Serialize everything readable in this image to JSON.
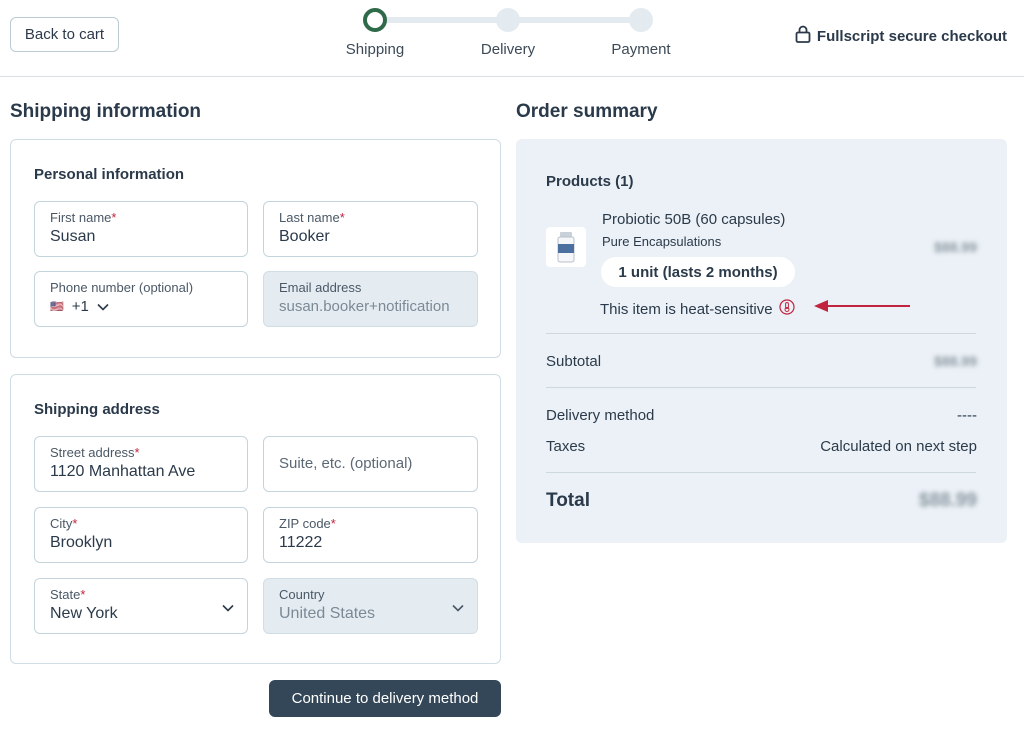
{
  "header": {
    "back_label": "Back to cart",
    "steps": [
      "Shipping",
      "Delivery",
      "Payment"
    ],
    "secure_label": "Fullscript secure checkout"
  },
  "shipping": {
    "title": "Shipping information",
    "personal": {
      "title": "Personal information",
      "first_name_label": "First name",
      "first_name_value": "Susan",
      "last_name_label": "Last name",
      "last_name_value": "Booker",
      "phone_label": "Phone number (optional)",
      "phone_flag": "🇺🇸",
      "phone_code": "+1",
      "email_label": "Email address",
      "email_value": "susan.booker+notification"
    },
    "address": {
      "title": "Shipping address",
      "street_label": "Street address",
      "street_value": "1120 Manhattan Ave",
      "suite_placeholder": "Suite, etc. (optional)",
      "city_label": "City",
      "city_value": "Brooklyn",
      "zip_label": "ZIP code",
      "zip_value": "11222",
      "state_label": "State",
      "state_value": "New York",
      "country_label": "Country",
      "country_value": "United States"
    },
    "required_mark": "*",
    "continue_label": "Continue to delivery method"
  },
  "summary": {
    "title": "Order summary",
    "products_label": "Products (1)",
    "product_name": "Probiotic 50B (60 capsules)",
    "product_brand": "Pure Encapsulations",
    "product_price": "$88.99",
    "unit_label": "1 unit (lasts 2 months)",
    "heat_label": "This item is heat-sensitive",
    "subtotal_label": "Subtotal",
    "subtotal_value": "$88.99",
    "delivery_label": "Delivery method",
    "delivery_value": "----",
    "taxes_label": "Taxes",
    "taxes_value": "Calculated on next step",
    "total_label": "Total",
    "total_value": "$88.99"
  },
  "colors": {
    "accent_green": "#2f6a4b",
    "button_dark": "#344758",
    "required_red": "#c0243e",
    "annotation_red": "#c0243e",
    "summary_bg": "#ebf1f6"
  }
}
